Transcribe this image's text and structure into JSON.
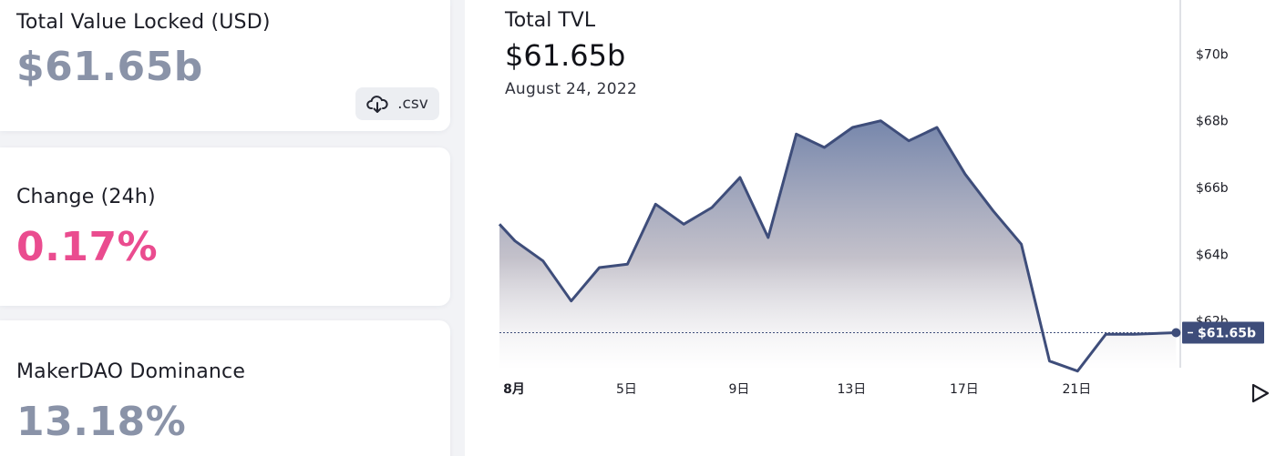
{
  "cards": {
    "tvl": {
      "label": "Total Value Locked (USD)",
      "value": "$61.65b",
      "csv_label": ".csv"
    },
    "change": {
      "label": "Change (24h)",
      "value": "0.17%"
    },
    "dominance": {
      "label": "MakerDAO Dominance",
      "value": "13.18%"
    }
  },
  "icons": {
    "csv": "cloud-download-icon",
    "play": "play-icon"
  },
  "colors": {
    "line": "#3e4d7a",
    "area_top": "#6f80a7",
    "area_bottom": "#ffffff",
    "value_gray": "#8a93a8",
    "value_pink": "#ea4c8f",
    "label_bg": "#3e4d7a"
  },
  "chart": {
    "title": "Total TVL",
    "value": "$61.65b",
    "date": "August 24, 2022"
  },
  "chart_data": {
    "type": "area",
    "x_labels": [
      {
        "label": "8月",
        "day": 1,
        "bold": true
      },
      {
        "label": "5日",
        "day": 5
      },
      {
        "label": "9日",
        "day": 9
      },
      {
        "label": "13日",
        "day": 13
      },
      {
        "label": "17日",
        "day": 17
      },
      {
        "label": "21日",
        "day": 21
      }
    ],
    "x_range": [
      0,
      24.2
    ],
    "y_ticks": [
      {
        "label": "$62b",
        "value": 62
      },
      {
        "label": "$64b",
        "value": 64
      },
      {
        "label": "$66b",
        "value": 66
      },
      {
        "label": "$68b",
        "value": 68
      },
      {
        "label": "$70b",
        "value": 70
      }
    ],
    "y_range": [
      60.6,
      71.4
    ],
    "points": [
      [
        0.0,
        64.9
      ],
      [
        0.55,
        64.4
      ],
      [
        1.55,
        63.8
      ],
      [
        2.55,
        62.6
      ],
      [
        3.55,
        63.6
      ],
      [
        4.55,
        63.7
      ],
      [
        5.55,
        65.5
      ],
      [
        6.55,
        64.9
      ],
      [
        7.55,
        65.4
      ],
      [
        8.55,
        66.3
      ],
      [
        9.55,
        64.5
      ],
      [
        10.55,
        67.6
      ],
      [
        11.55,
        67.2
      ],
      [
        12.55,
        67.8
      ],
      [
        13.55,
        68.0
      ],
      [
        14.55,
        67.4
      ],
      [
        15.55,
        67.8
      ],
      [
        16.55,
        66.4
      ],
      [
        17.55,
        65.3
      ],
      [
        18.55,
        64.3
      ],
      [
        19.55,
        60.8
      ],
      [
        20.55,
        60.5
      ],
      [
        21.55,
        61.6
      ],
      [
        22.55,
        61.6
      ],
      [
        24.05,
        61.65
      ]
    ],
    "current": {
      "x": 24.05,
      "y": 61.65,
      "label": "$61.65b"
    },
    "grid": false,
    "legend": "none"
  }
}
